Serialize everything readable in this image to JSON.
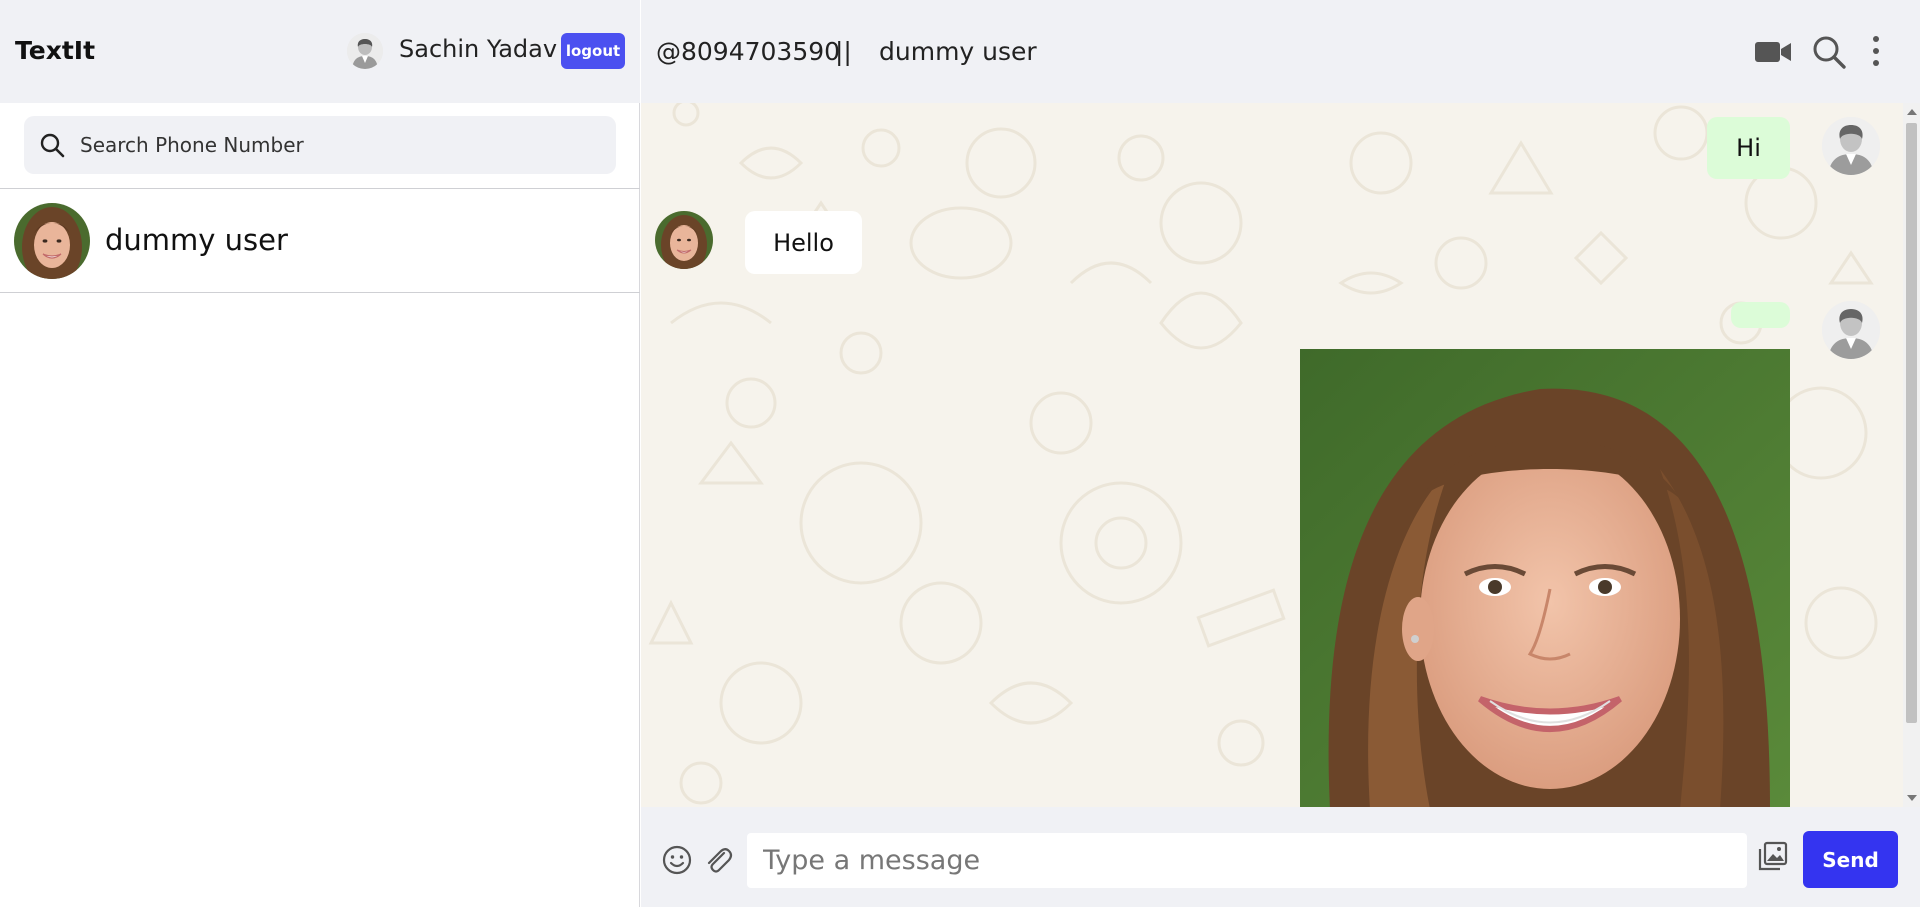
{
  "app": {
    "brand": "TextIt"
  },
  "user": {
    "name": "Sachin Yadav",
    "logout_label": "logout"
  },
  "search": {
    "placeholder": "Search Phone Number",
    "value": ""
  },
  "contacts": [
    {
      "name": "dummy user"
    }
  ],
  "chat": {
    "phone": "@8094703590",
    "separator": "||",
    "name": "dummy user"
  },
  "messages": [
    {
      "direction": "out",
      "text": "Hi"
    },
    {
      "direction": "in",
      "text": "Hello"
    },
    {
      "direction": "out",
      "text": "",
      "has_image": true
    }
  ],
  "composer": {
    "placeholder": "Type a message",
    "send_label": "Send"
  },
  "colors": {
    "accent": "#4b50f0",
    "send": "#3434f0",
    "outgoing_bubble": "#dcfcd8",
    "chat_bg": "#f6f3ec",
    "header_bg": "#f0f1f5"
  },
  "icons": [
    "search-icon",
    "video-call-icon",
    "chat-search-icon",
    "more-vertical-icon",
    "emoji-icon",
    "attach-icon",
    "image-upload-icon"
  ]
}
